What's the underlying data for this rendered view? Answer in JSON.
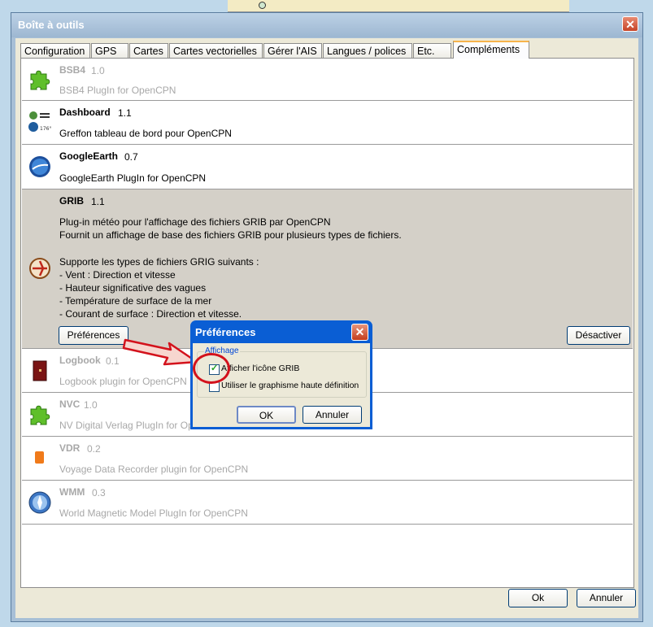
{
  "window": {
    "title": "Boîte à outils",
    "close_glyph": "✕"
  },
  "tabs": [
    "Configuration",
    "GPS",
    "Cartes",
    "Cartes vectorielles",
    "Gérer l'AIS",
    "Langues / polices",
    "Etc.",
    "Compléments"
  ],
  "plugins": [
    {
      "name": "BSB4",
      "version": "1.0",
      "desc": "BSB4 PlugIn for OpenCPN",
      "icon": "puzzle-icon",
      "enabled": false
    },
    {
      "name": "Dashboard",
      "version": "1.1",
      "desc": "Greffon tableau de bord pour OpenCPN",
      "icon": "dashboard-icon",
      "enabled": true
    },
    {
      "name": "GoogleEarth",
      "version": "0.7",
      "desc": "GoogleEarth PlugIn for OpenCPN",
      "icon": "globe-icon",
      "enabled": true
    },
    {
      "name": "GRIB",
      "version": "1.1",
      "desc_lines": [
        "Plug-in météo pour l'affichage des fichiers GRIB par OpenCPN",
        "Fournit un affichage de base des fichiers GRIB pour plusieurs types de fichiers.",
        "",
        "Supporte les types de fichiers GRIG suivants :",
        "- Vent : Direction et vitesse",
        "- Hauteur significative des vagues",
        "- Température de surface de la mer",
        "- Courant de surface : Direction et vitesse."
      ],
      "icon": "grib-icon",
      "enabled": true,
      "selected": true,
      "prefs_label": "Préférences",
      "disable_label": "Désactiver"
    },
    {
      "name": "Logbook",
      "version": "0.1",
      "desc": "Logbook plugin for OpenCPN",
      "icon": "logbook-icon",
      "enabled": false
    },
    {
      "name": "NVC",
      "version": "1.0",
      "desc": "NV Digital Verlag PlugIn for OpenCPN",
      "icon": "puzzle-icon",
      "enabled": false
    },
    {
      "name": "VDR",
      "version": "0.2",
      "desc": "Voyage Data Recorder plugin for OpenCPN",
      "icon": "vdr-icon",
      "enabled": false
    },
    {
      "name": "WMM",
      "version": "0.3",
      "desc": "World Magnetic Model PlugIn for OpenCPN",
      "icon": "compass-icon",
      "enabled": false
    }
  ],
  "footer": {
    "ok": "Ok",
    "cancel": "Annuler"
  },
  "prefs_dialog": {
    "title": "Préférences",
    "group": "Affichage",
    "options": [
      {
        "label": "Afficher l'icône GRIB",
        "checked": true
      },
      {
        "label": "Utiliser le graphisme haute définition",
        "checked": false
      }
    ],
    "ok": "OK",
    "cancel": "Annuler"
  },
  "colors": {
    "annotation": "#d3121c",
    "window_frame": "#a7bfd6",
    "dialog_frame": "#0a5ed4",
    "active_tab_accent": "#f7b44c"
  }
}
